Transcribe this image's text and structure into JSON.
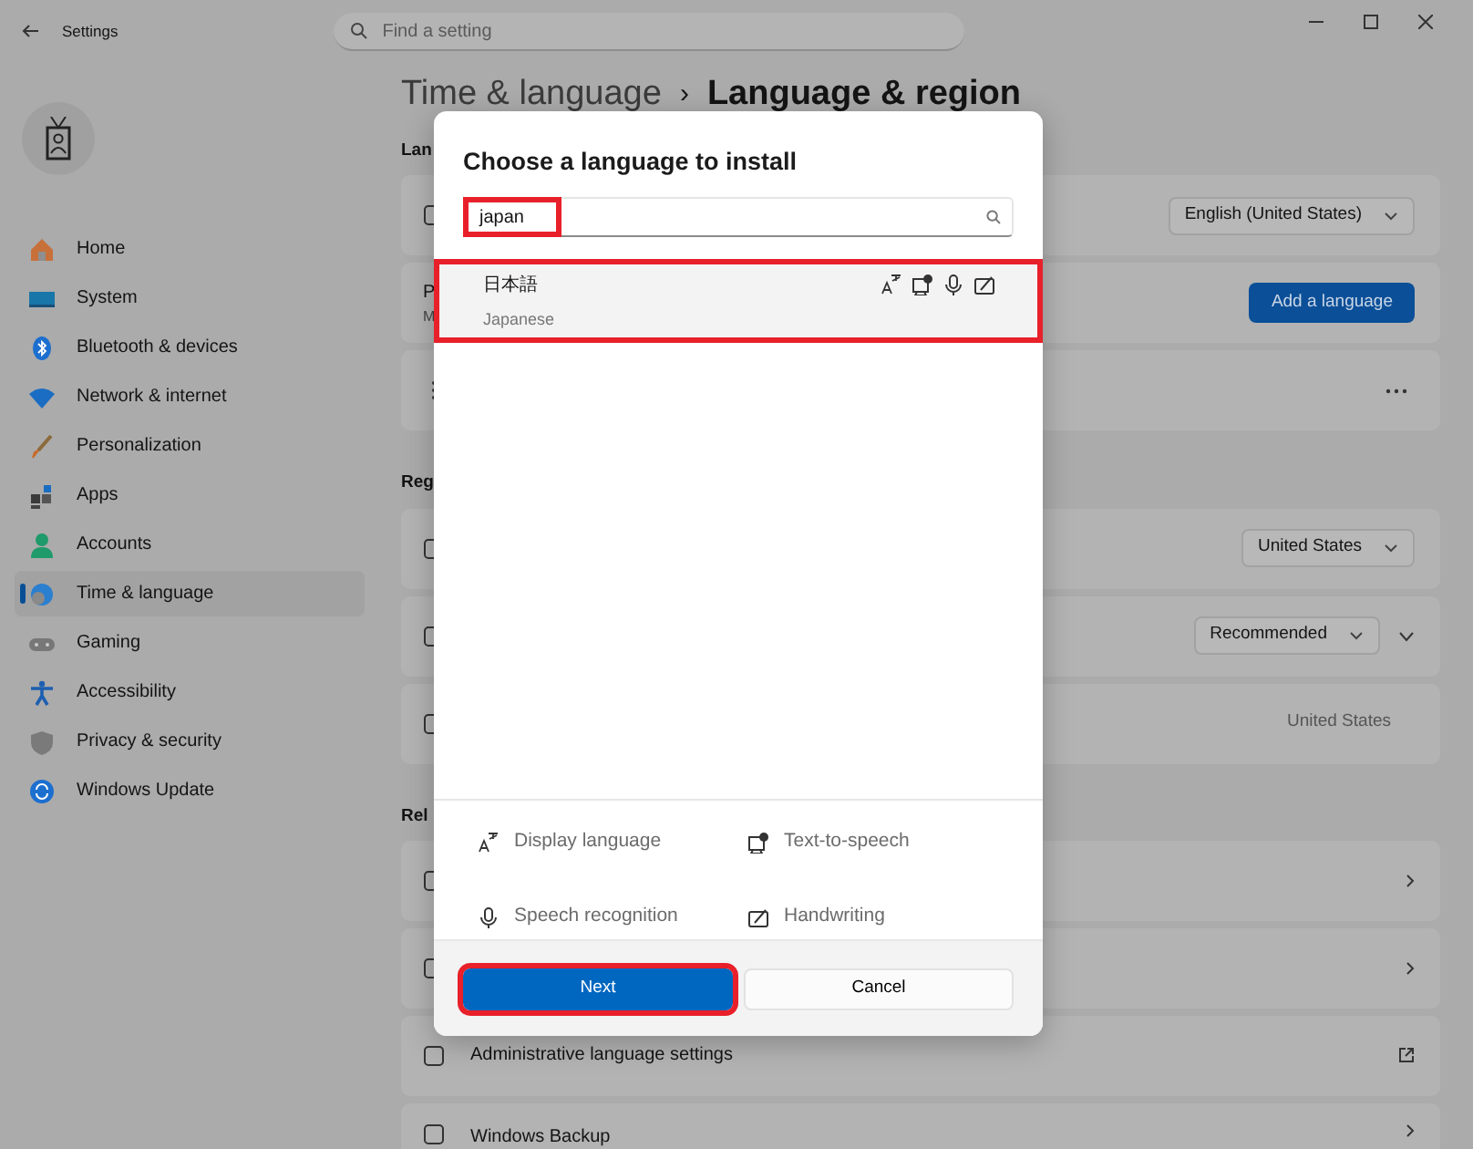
{
  "window": {
    "title": "Settings",
    "search": {
      "placeholder": "Find a setting"
    }
  },
  "sidebar": {
    "items": [
      {
        "label": "Home",
        "selected": false
      },
      {
        "label": "System",
        "selected": false
      },
      {
        "label": "Bluetooth & devices",
        "selected": false
      },
      {
        "label": "Network & internet",
        "selected": false
      },
      {
        "label": "Personalization",
        "selected": false
      },
      {
        "label": "Apps",
        "selected": false
      },
      {
        "label": "Accounts",
        "selected": false
      },
      {
        "label": "Time & language",
        "selected": true
      },
      {
        "label": "Gaming",
        "selected": false
      },
      {
        "label": "Accessibility",
        "selected": false
      },
      {
        "label": "Privacy & security",
        "selected": false
      },
      {
        "label": "Windows Update",
        "selected": false
      }
    ]
  },
  "breadcrumb": {
    "parent": "Time & language",
    "separator": "›",
    "current": "Language & region"
  },
  "sections": [
    {
      "heading": "Lan",
      "rows": [
        {
          "kind": "icon",
          "control": {
            "kind": "dropdown",
            "text": "English (United States)"
          }
        },
        {
          "kind": "text",
          "title": "P",
          "subtitle": "M",
          "control": {
            "kind": "button",
            "text": "Add a language"
          }
        },
        {
          "kind": "grip",
          "control": {
            "kind": "more"
          }
        }
      ]
    },
    {
      "heading": "Reg",
      "rows": [
        {
          "kind": "icon",
          "control": {
            "kind": "dropdown",
            "text": "United States"
          }
        },
        {
          "kind": "icon",
          "control": {
            "kind": "dropdown-expand",
            "text": "Recommended"
          }
        },
        {
          "kind": "icon",
          "control": {
            "kind": "value",
            "text": "United States"
          }
        }
      ]
    },
    {
      "heading": "Rel",
      "rows": [
        {
          "kind": "icon",
          "control": {
            "kind": "chevron"
          }
        },
        {
          "kind": "icon",
          "control": {
            "kind": "chevron"
          }
        },
        {
          "kind": "icon",
          "title": "Administrative language settings",
          "control": {
            "kind": "external"
          }
        },
        {
          "kind": "tall",
          "title": "Windows Backup",
          "control": {
            "kind": "chevron"
          }
        }
      ]
    }
  ],
  "dialog": {
    "title": "Choose a language to install",
    "search": {
      "value": "japan",
      "highlighted": true
    },
    "results": [
      {
        "native": "日本語",
        "english": "Japanese",
        "selected": true,
        "highlighted": true
      }
    ],
    "legend": [
      "Display language",
      "Text-to-speech",
      "Speech recognition",
      "Handwriting"
    ],
    "buttons": [
      {
        "kind": "primary",
        "label": "Next",
        "highlighted": true
      },
      {
        "kind": "secondary",
        "label": "Cancel",
        "highlighted": false
      }
    ]
  }
}
